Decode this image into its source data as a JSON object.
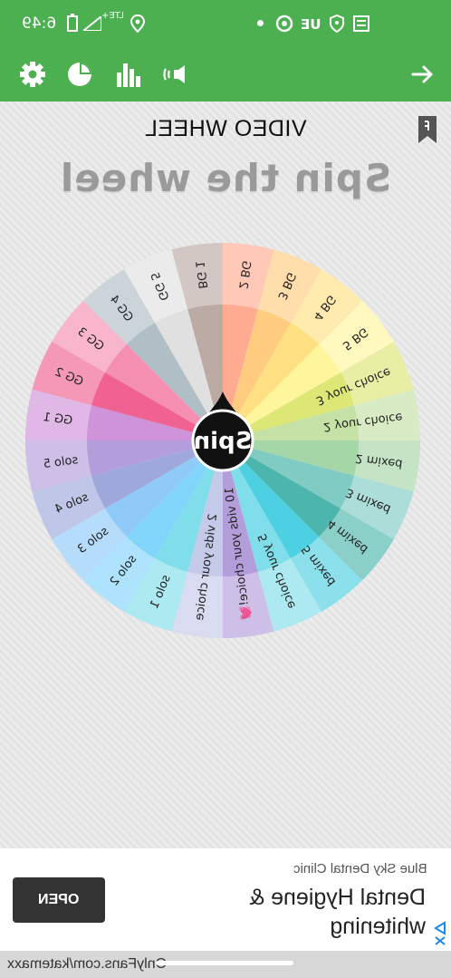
{
  "status_bar": {
    "time": "6:49",
    "network": "LTE+",
    "carrier": "UE",
    "icons": [
      "signal-icon",
      "battery-icon",
      "location-icon",
      "dot-icon",
      "vpn-icon",
      "shield-icon",
      "message-icon"
    ]
  },
  "toolbar": {
    "icons": [
      "settings-icon",
      "pie-chart-icon",
      "bar-chart-icon",
      "sound-icon",
      "arrow-right-icon"
    ]
  },
  "header": {
    "title": "VIDEO WHEEL",
    "subtitle": "Spin the wheel"
  },
  "wheel": {
    "center_label": "Spin",
    "segments": [
      {
        "label": "BG 1",
        "color": "#bcaaa4"
      },
      {
        "label": "GG 5",
        "color": "#e0e0e0"
      },
      {
        "label": "GG 4",
        "color": "#b0bec5"
      },
      {
        "label": "GG 3",
        "color": "#f48fb1"
      },
      {
        "label": "GG 2",
        "color": "#f06292"
      },
      {
        "label": "GG 1",
        "color": "#ce93d8"
      },
      {
        "label": "solo 5",
        "color": "#b39ddb"
      },
      {
        "label": "solo 4",
        "color": "#9fa8da"
      },
      {
        "label": "solo 3",
        "color": "#90caf9"
      },
      {
        "label": "solo 2",
        "color": "#81d4fa"
      },
      {
        "label": "solo 1",
        "color": "#80deea"
      },
      {
        "label": "2 vids your choice",
        "color": "#c5cae9"
      },
      {
        "label": "10 vids your choice!💓",
        "color": "#b39ddb"
      },
      {
        "label": "5 your choice",
        "color": "#80deea"
      },
      {
        "label": "5 mixed",
        "color": "#4dd0e1"
      },
      {
        "label": "4 mixed",
        "color": "#4db6ac"
      },
      {
        "label": "3 mixed",
        "color": "#80cbc4"
      },
      {
        "label": "2 mixed",
        "color": "#a5d6a7"
      },
      {
        "label": "2 your choice",
        "color": "#c5e1a5"
      },
      {
        "label": "3 your choice",
        "color": "#dce775"
      },
      {
        "label": "5 BG",
        "color": "#fff59d"
      },
      {
        "label": "4 BG",
        "color": "#ffe082"
      },
      {
        "label": "3 BG",
        "color": "#ffcc80"
      },
      {
        "label": "2 BG",
        "color": "#ffab91"
      }
    ]
  },
  "ad": {
    "sponsor": "Blue Sky Dental Clinic",
    "headline": "Dental Hygiene & whitening",
    "cta": "OPEN"
  },
  "url_bar": {
    "url": "OnlyFans.com/katemaxx"
  }
}
